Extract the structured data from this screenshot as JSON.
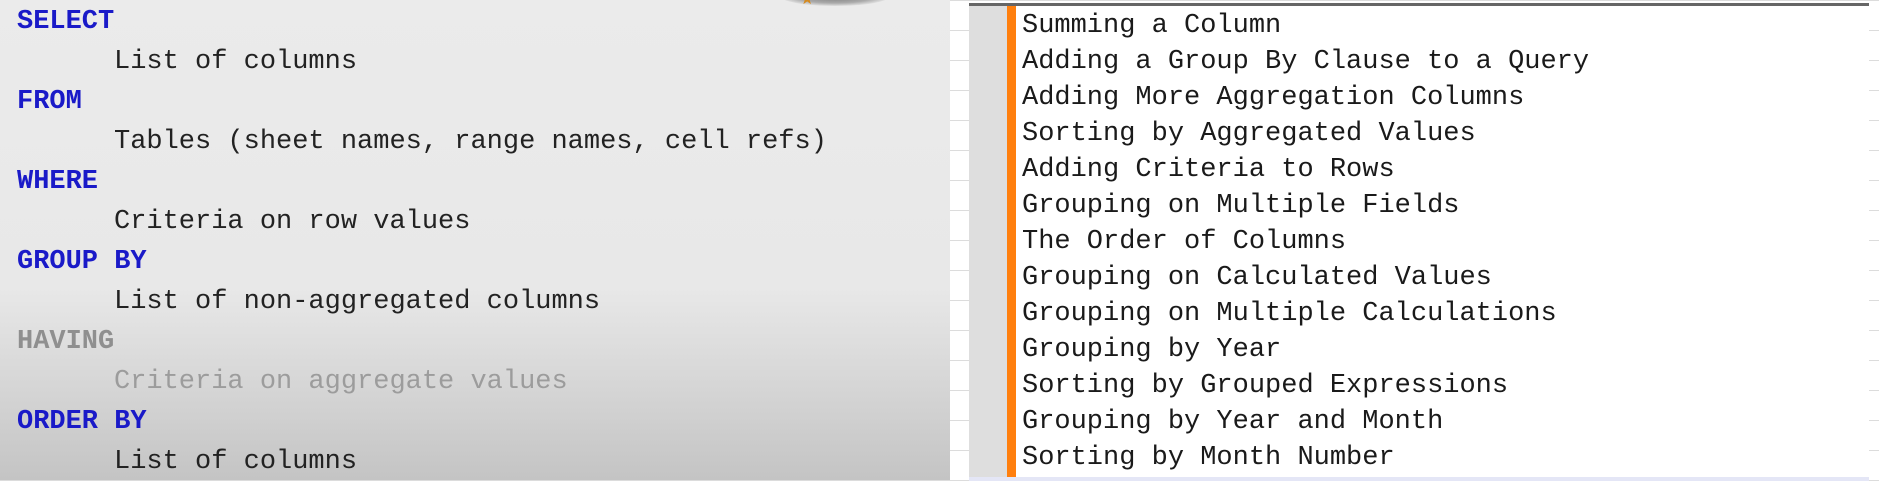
{
  "sql_syntax": [
    {
      "keyword": "SELECT",
      "description": "List of columns",
      "dimmed": false
    },
    {
      "keyword": "FROM",
      "description": "Tables (sheet names, range names, cell refs)",
      "dimmed": false
    },
    {
      "keyword": "WHERE",
      "description": "Criteria on row values",
      "dimmed": false
    },
    {
      "keyword": "GROUP BY",
      "description": "List of non-aggregated columns",
      "dimmed": false
    },
    {
      "keyword": "HAVING",
      "description": "Criteria on aggregate values",
      "dimmed": true
    },
    {
      "keyword": "ORDER BY",
      "description": "List of columns",
      "dimmed": false
    }
  ],
  "topics": [
    "Summing a Column",
    "Adding a Group By Clause to a Query",
    "Adding More Aggregation Columns",
    "Sorting by Aggregated Values",
    "Adding Criteria to Rows",
    "Grouping on Multiple Fields",
    "The Order of Columns",
    "Grouping on Calculated Values",
    "Grouping on Multiple Calculations",
    "Grouping by Year",
    "Sorting by Grouped Expressions",
    "Grouping by Year and Month",
    "Sorting by Month Number"
  ],
  "colors": {
    "keyword": "#1a1ac8",
    "accent_bar": "#ff7f0e",
    "dimmed": "#8f8f8f"
  }
}
